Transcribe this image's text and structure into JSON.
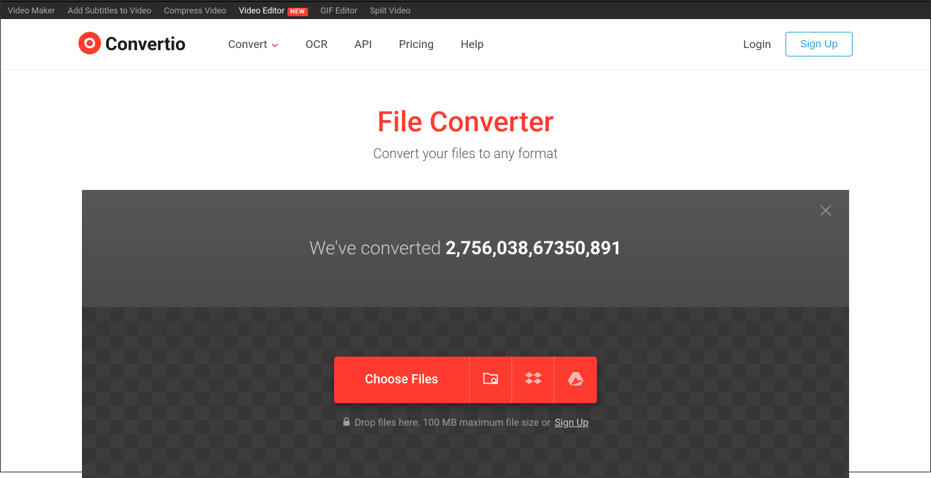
{
  "topbar": {
    "items": [
      {
        "label": "Video Maker",
        "active": false
      },
      {
        "label": "Add Subtitles to Video",
        "active": false
      },
      {
        "label": "Compress Video",
        "active": false
      },
      {
        "label": "Video Editor",
        "active": true,
        "badge": "NEW"
      },
      {
        "label": "GIF Editor",
        "active": false
      },
      {
        "label": "Split Video",
        "active": false
      }
    ]
  },
  "brand": "Convertio",
  "nav": {
    "convert": "Convert",
    "ocr": "OCR",
    "api": "API",
    "pricing": "Pricing",
    "help": "Help",
    "login": "Login",
    "signup": "Sign Up"
  },
  "hero": {
    "title": "File Converter",
    "subtitle": "Convert your files to any format"
  },
  "stats": {
    "prefix": "We've converted ",
    "count": "2,756,038,67350,891"
  },
  "upload": {
    "choose": "Choose Files",
    "hint_pre": "Drop files here. 100 MB maximum file size or ",
    "signup": "Sign Up"
  },
  "colors": {
    "accent": "#ff3b30",
    "link": "#2ca0e8"
  }
}
